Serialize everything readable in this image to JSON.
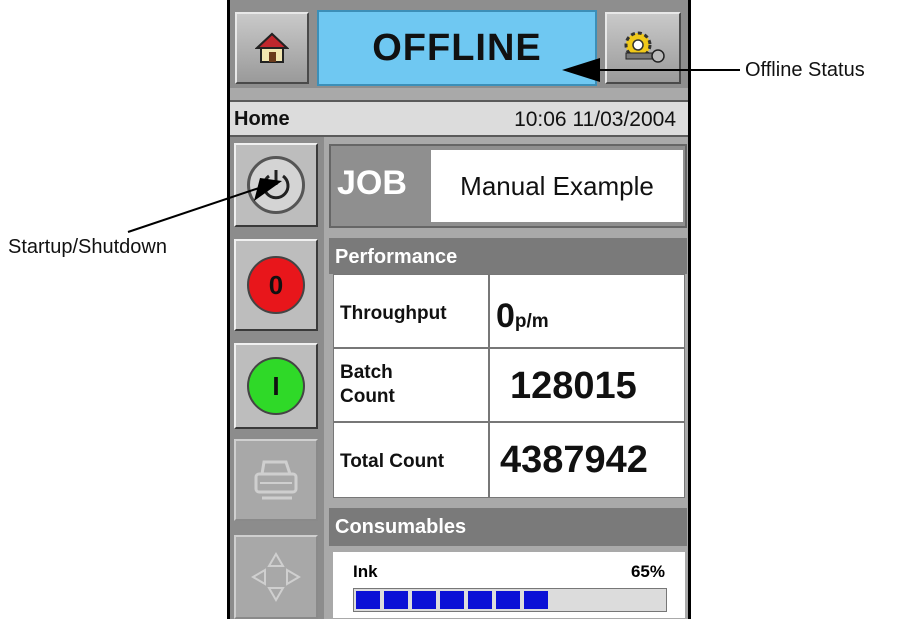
{
  "status": {
    "text": "OFFLINE"
  },
  "info_bar": {
    "screen_name": "Home",
    "datetime": "10:06 11/03/2004"
  },
  "side_buttons": [
    {
      "name": "startup-shutdown",
      "icon": "power-icon"
    },
    {
      "name": "stop",
      "label": "0",
      "color": "#e8161b"
    },
    {
      "name": "start",
      "label": "I",
      "color": "#2fd928"
    },
    {
      "name": "print",
      "icon": "printer-icon"
    },
    {
      "name": "navigate",
      "icon": "arrows-icon"
    }
  ],
  "job": {
    "tag": "JOB",
    "name": "Manual Example"
  },
  "performance": {
    "heading": "Performance",
    "throughput": {
      "label": "Throughput",
      "value": "0",
      "unit": "p/m"
    },
    "batch_count": {
      "label_line1": "Batch",
      "label_line2": "Count",
      "value": "128015"
    },
    "total_count": {
      "label": "Total Count",
      "value": "4387942"
    }
  },
  "consumables": {
    "heading": "Consumables",
    "ink": {
      "label": "Ink",
      "percent_text": "65%",
      "level": 0.65
    }
  },
  "annotations": {
    "offline": "Offline Status",
    "startup": "Startup/Shutdown"
  },
  "colors": {
    "status_bg": "#6fc8f2",
    "ink_fill": "#0b10d6"
  }
}
